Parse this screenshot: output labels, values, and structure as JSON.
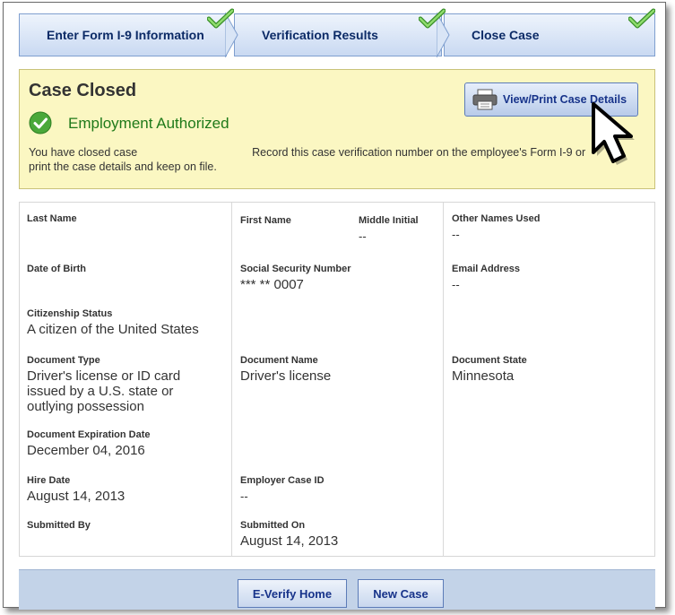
{
  "steps": [
    {
      "label": "Enter Form I-9 Information"
    },
    {
      "label": "Verification Results"
    },
    {
      "label": "Close Case"
    }
  ],
  "status": {
    "title": "Case Closed",
    "result": "Employment Authorized",
    "message_part1": "You have closed case",
    "message_part2": "Record this case verification number on the employee's Form I-9 or print the case details and keep on file.",
    "print_button": "View/Print Case Details"
  },
  "details": {
    "last_name": {
      "label": "Last Name",
      "value": ""
    },
    "first_name": {
      "label": "First Name",
      "value": ""
    },
    "middle_initial": {
      "label": "Middle Initial",
      "value": "--"
    },
    "other_names": {
      "label": "Other Names Used",
      "value": "--"
    },
    "dob": {
      "label": "Date of Birth",
      "value": ""
    },
    "ssn": {
      "label": "Social Security Number",
      "value": "*** ** 0007"
    },
    "email": {
      "label": "Email Address",
      "value": "--"
    },
    "citizenship": {
      "label": "Citizenship Status",
      "value": "A citizen of the United States"
    },
    "doc_type": {
      "label": "Document Type",
      "value": "Driver's license or ID card issued by a U.S. state or outlying possession"
    },
    "doc_name": {
      "label": "Document Name",
      "value": "Driver's license"
    },
    "doc_state": {
      "label": "Document State",
      "value": "Minnesota"
    },
    "doc_exp": {
      "label": "Document Expiration Date",
      "value": "December 04, 2016"
    },
    "hire_date": {
      "label": "Hire Date",
      "value": "August 14, 2013"
    },
    "employer_case_id": {
      "label": "Employer Case ID",
      "value": "--"
    },
    "submitted_by": {
      "label": "Submitted By",
      "value": ""
    },
    "submitted_on": {
      "label": "Submitted On",
      "value": "August 14, 2013"
    }
  },
  "footer": {
    "home_button": "E-Verify Home",
    "new_case_button": "New Case"
  },
  "colors": {
    "accent_green": "#1f7a1a",
    "status_bg": "#fbf7c2",
    "step_text": "#0b2a66",
    "footer_bg": "#c3d3e8"
  },
  "icons": [
    "checkmark-icon",
    "success-circle-icon",
    "printer-icon",
    "pointer-cursor-icon"
  ]
}
